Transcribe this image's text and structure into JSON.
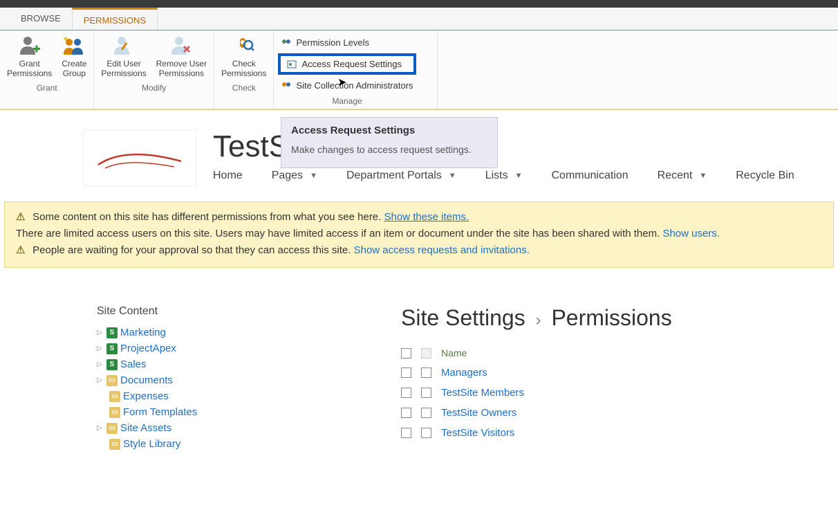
{
  "tabs": {
    "browse": "BROWSE",
    "permissions": "PERMISSIONS"
  },
  "ribbon": {
    "grant": {
      "label": "Grant",
      "grant_permissions": "Grant\nPermissions",
      "create_group": "Create\nGroup"
    },
    "modify": {
      "label": "Modify",
      "edit_user": "Edit User\nPermissions",
      "remove_user": "Remove User\nPermissions"
    },
    "check": {
      "label": "Check",
      "check_permissions": "Check\nPermissions"
    },
    "manage": {
      "label": "Manage",
      "permission_levels": "Permission Levels",
      "access_request_settings": "Access Request Settings",
      "site_collection_admins": "Site Collection Administrators"
    }
  },
  "tooltip": {
    "title": "Access Request Settings",
    "text": "Make changes to access request settings."
  },
  "site": {
    "title": "TestSite",
    "nav": {
      "home": "Home",
      "pages": "Pages",
      "department_portals": "Department Portals",
      "lists": "Lists",
      "communication": "Communication",
      "recent": "Recent",
      "recycle_bin": "Recycle Bin"
    }
  },
  "banner": {
    "line1_text": "Some content on this site has different permissions from what you see here.",
    "line1_link": "Show these items.",
    "line2_text": "There are limited access users on this site. Users may have limited access if an item or document under the site has been shared with them.",
    "line2_link": "Show users.",
    "line3_text": "People are waiting for your approval so that they can access this site.",
    "line3_link": "Show access requests and invitations."
  },
  "site_content": {
    "title": "Site Content",
    "items": {
      "marketing": "Marketing",
      "projectapex": "ProjectApex",
      "sales": "Sales",
      "documents": "Documents",
      "expenses": "Expenses",
      "form_templates": "Form Templates",
      "site_assets": "Site Assets",
      "style_library": "Style Library"
    }
  },
  "settings": {
    "breadcrumb_a": "Site Settings",
    "breadcrumb_b": "Permissions",
    "header_name": "Name",
    "rows": {
      "managers": "Managers",
      "members": "TestSite Members",
      "owners": "TestSite Owners",
      "visitors": "TestSite Visitors"
    }
  }
}
